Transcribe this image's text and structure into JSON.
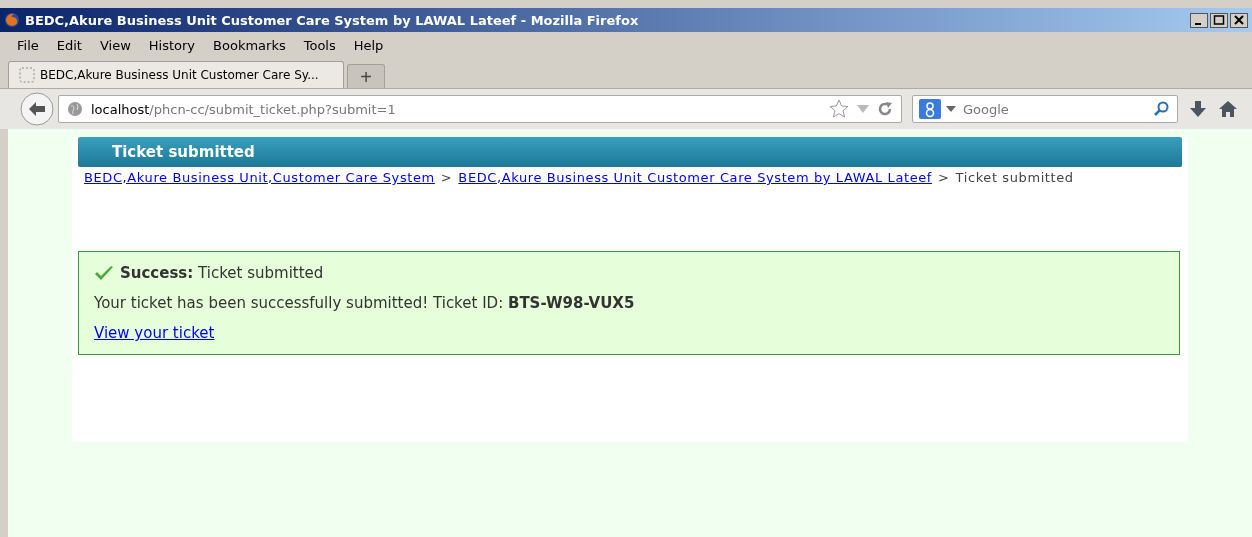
{
  "window": {
    "title": "BEDC,Akure Business Unit Customer Care System by LAWAL Lateef - Mozilla Firefox"
  },
  "menu": [
    "File",
    "Edit",
    "View",
    "History",
    "Bookmarks",
    "Tools",
    "Help"
  ],
  "tabs": [
    {
      "label": "BEDC,Akure Business Unit Customer Care Sy...",
      "selected": true
    }
  ],
  "new_tab": "+",
  "address": {
    "host": "localhost",
    "path": "/phcn-cc/submit_ticket.php?submit=1"
  },
  "search": {
    "placeholder": "Google"
  },
  "page": {
    "header": "Ticket submitted",
    "breadcrumb": [
      {
        "kind": "link",
        "text": "BEDC,Akure Business Unit,Customer Care System"
      },
      {
        "kind": "sep",
        "text": ">"
      },
      {
        "kind": "link",
        "text": "BEDC,Akure Business Unit Customer Care System by LAWAL Lateef"
      },
      {
        "kind": "sep",
        "text": ">"
      },
      {
        "kind": "text",
        "text": "Ticket submitted"
      }
    ],
    "notice": {
      "title": "Success:",
      "message": "Ticket submitted",
      "detail": "Your ticket has been successfully submitted! Ticket ID: **BTS-W98-VUX5**",
      "link": "View your ticket"
    }
  }
}
